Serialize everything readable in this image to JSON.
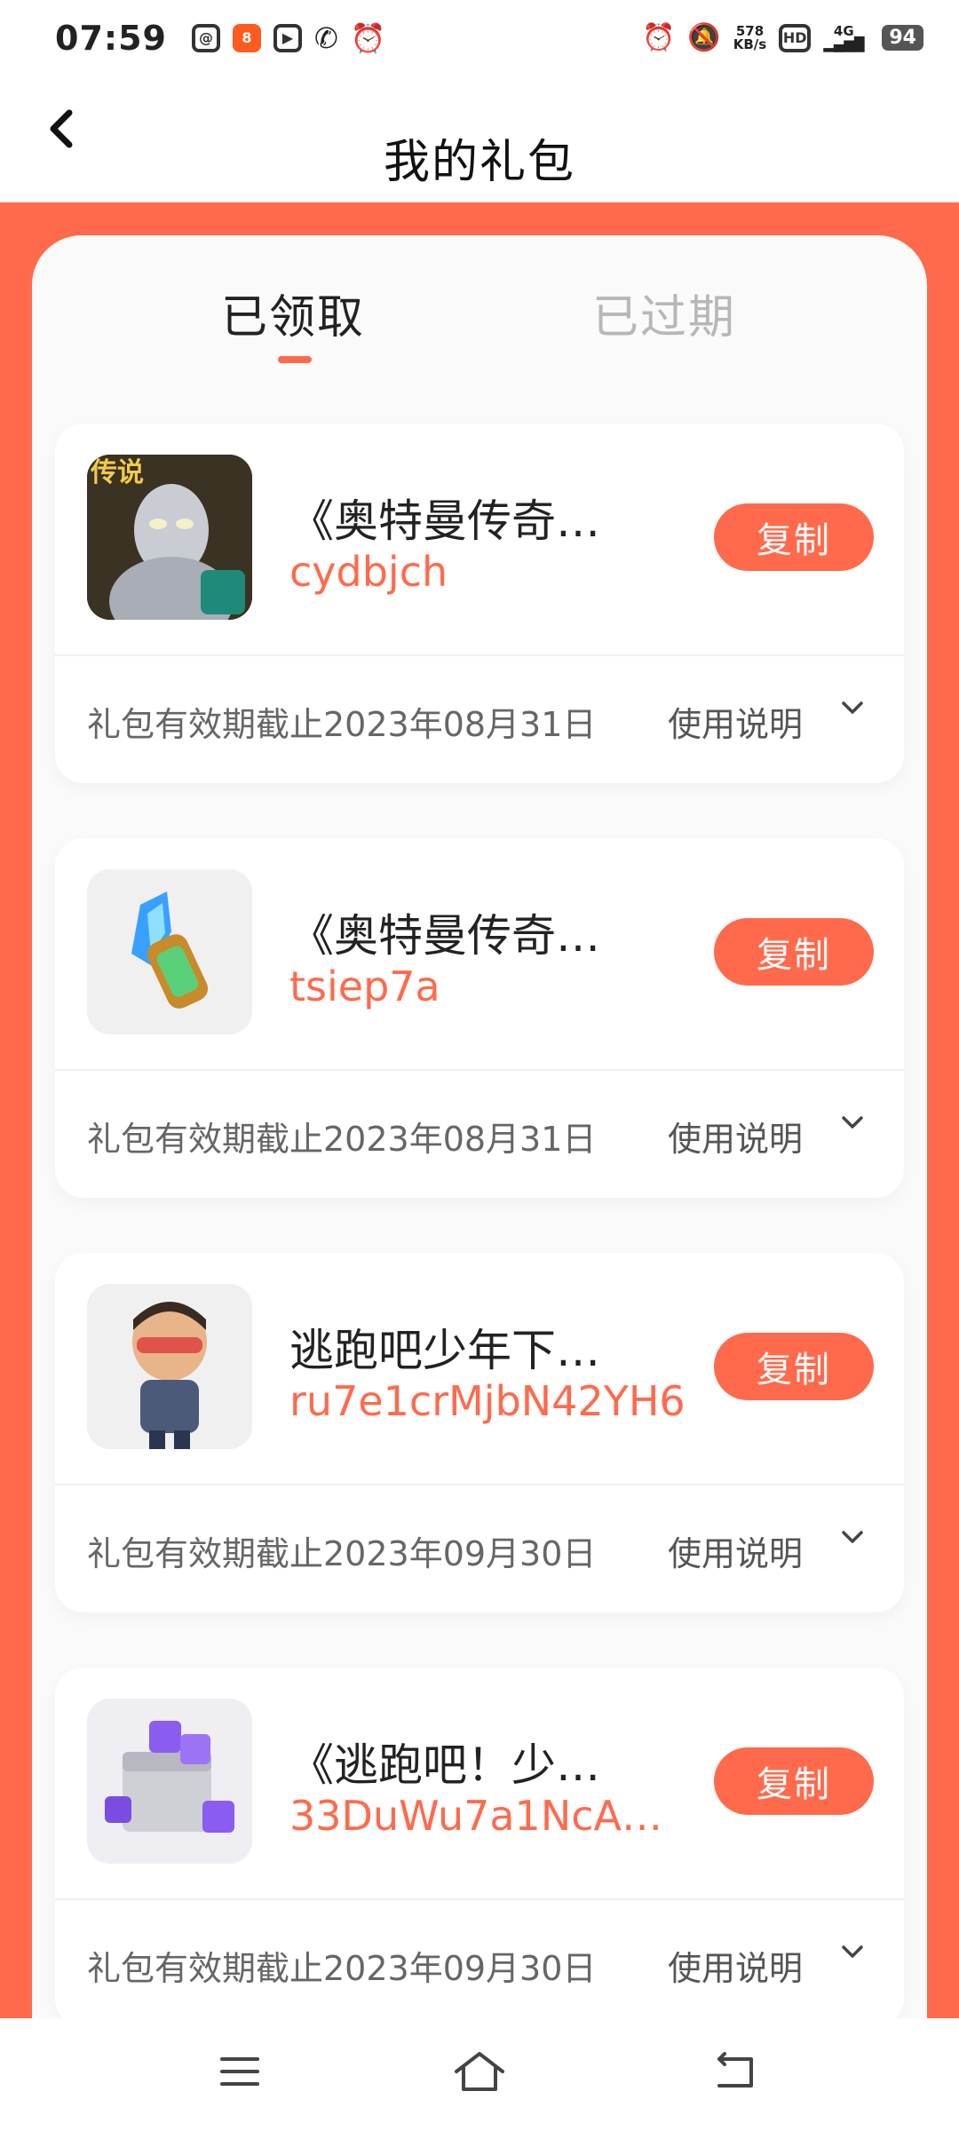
{
  "status": {
    "time": "07:59",
    "net_speed": "578",
    "net_unit": "KB/s",
    "hd": "HD",
    "signal": "4G",
    "battery": "94"
  },
  "header": {
    "title": "我的礼包"
  },
  "tabs": [
    {
      "label": "已领取"
    },
    {
      "label": "已过期"
    }
  ],
  "cards": [
    {
      "name": "《奥特曼传奇…",
      "code": "cydbjch",
      "expire": "礼包有效期截止2023年08月31日",
      "usage": "使用说明",
      "copy": "复制",
      "thumb_badge": "传说"
    },
    {
      "name": "《奥特曼传奇…",
      "code": "tsiep7a",
      "expire": "礼包有效期截止2023年08月31日",
      "usage": "使用说明",
      "copy": "复制"
    },
    {
      "name": "逃跑吧少年下…",
      "code": "ru7e1crMjbN42YH6",
      "expire": "礼包有效期截止2023年09月30日",
      "usage": "使用说明",
      "copy": "复制"
    },
    {
      "name": "《逃跑吧！少…",
      "code": "33DuWu7a1NcA…",
      "expire": "礼包有效期截止2023年09月30日",
      "usage": "使用说明",
      "copy": "复制"
    }
  ],
  "colors": {
    "accent": "#ff6a4c",
    "inactive_tab": "#b7b7b7"
  }
}
